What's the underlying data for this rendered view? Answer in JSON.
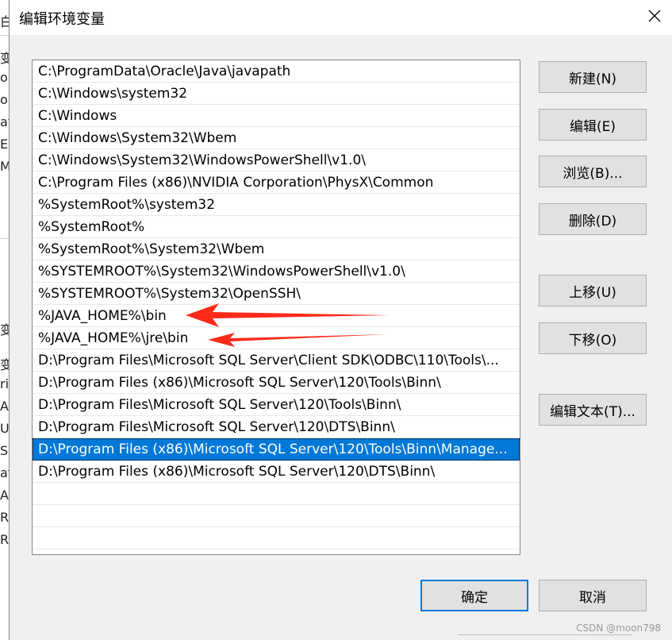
{
  "background_window": {
    "chars": [
      "白",
      "变量",
      "on",
      "on",
      "at",
      "E",
      "M",
      "变",
      "变量",
      "ri",
      "A",
      "U",
      "S",
      "at",
      "A",
      "R",
      "R"
    ]
  },
  "dialog": {
    "title": "编辑环境变量",
    "close_icon": "close-icon"
  },
  "path_list": {
    "items": [
      "C:\\ProgramData\\Oracle\\Java\\javapath",
      "C:\\Windows\\system32",
      "C:\\Windows",
      "C:\\Windows\\System32\\Wbem",
      "C:\\Windows\\System32\\WindowsPowerShell\\v1.0\\",
      "C:\\Program Files (x86)\\NVIDIA Corporation\\PhysX\\Common",
      "%SystemRoot%\\system32",
      "%SystemRoot%",
      "%SystemRoot%\\System32\\Wbem",
      "%SYSTEMROOT%\\System32\\WindowsPowerShell\\v1.0\\",
      "%SYSTEMROOT%\\System32\\OpenSSH\\",
      "%JAVA_HOME%\\bin",
      "%JAVA_HOME%\\jre\\bin",
      "D:\\Program Files\\Microsoft SQL Server\\Client SDK\\ODBC\\110\\Tools\\...",
      "D:\\Program Files (x86)\\Microsoft SQL Server\\120\\Tools\\Binn\\",
      "D:\\Program Files\\Microsoft SQL Server\\120\\Tools\\Binn\\",
      "D:\\Program Files\\Microsoft SQL Server\\120\\DTS\\Binn\\",
      "D:\\Program Files (x86)\\Microsoft SQL Server\\120\\Tools\\Binn\\Manage...",
      "D:\\Program Files (x86)\\Microsoft SQL Server\\120\\DTS\\Binn\\"
    ],
    "selected_index": 17,
    "highlight_color": "#0078d7"
  },
  "buttons": {
    "new": "新建(N)",
    "edit": "编辑(E)",
    "browse": "浏览(B)...",
    "delete": "删除(D)",
    "move_up": "上移(U)",
    "move_down": "下移(O)",
    "edit_text": "编辑文本(T)...",
    "ok": "确定",
    "cancel": "取消"
  },
  "annotation": {
    "arrow_color": "#ff2a1a"
  },
  "watermark": "CSDN @moon798"
}
